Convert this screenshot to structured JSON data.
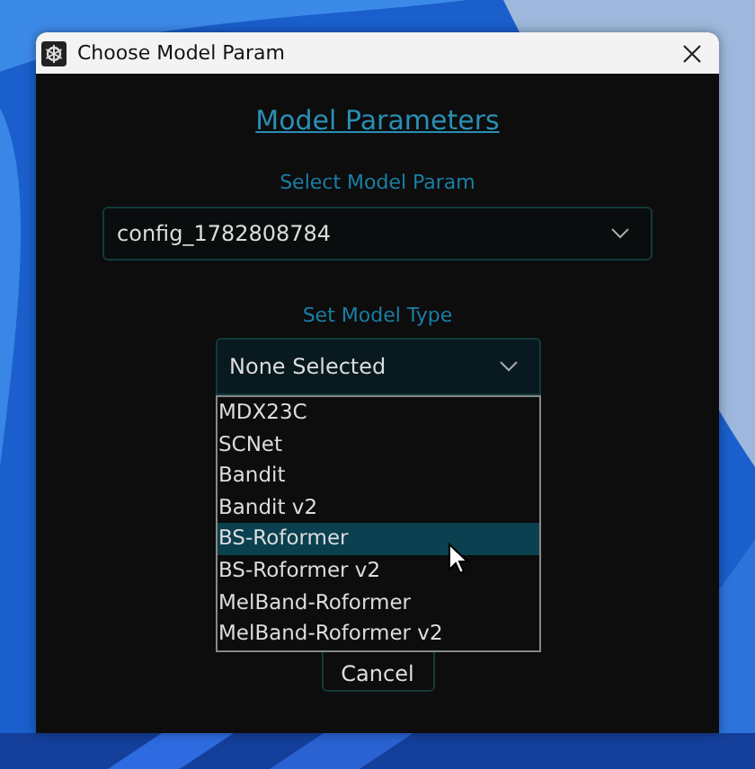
{
  "window": {
    "title": "Choose Model Param"
  },
  "heading": "Model Parameters",
  "model_param": {
    "label": "Select Model Param",
    "value": "config_1782808784"
  },
  "model_type": {
    "label": "Set Model Type",
    "value": "None Selected",
    "expanded": true,
    "options": [
      {
        "label": "MDX23C",
        "selected": false
      },
      {
        "label": "SCNet",
        "selected": false
      },
      {
        "label": "Bandit",
        "selected": false
      },
      {
        "label": "Bandit v2",
        "selected": false
      },
      {
        "label": "BS-Roformer",
        "selected": true
      },
      {
        "label": "BS-Roformer v2",
        "selected": false
      },
      {
        "label": "MelBand-Roformer",
        "selected": false
      },
      {
        "label": "MelBand-Roformer v2",
        "selected": false
      }
    ]
  },
  "buttons": [
    "Cancel"
  ]
}
